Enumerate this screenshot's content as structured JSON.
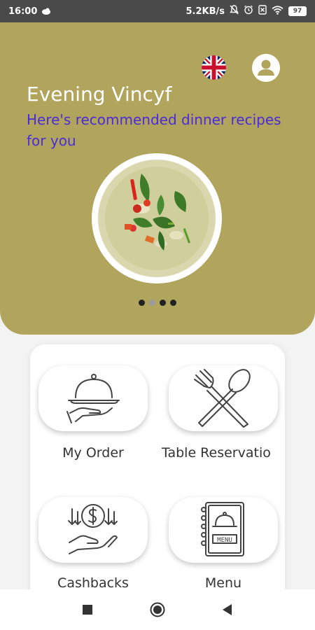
{
  "status_bar": {
    "time": "16:00",
    "net_speed": "5.2KB/s",
    "battery": "97"
  },
  "hero": {
    "greeting": "Evening Vincyf",
    "subtitle": "Here's recommended dinner recipes for you",
    "carousel": {
      "count": 4,
      "active_index": 1
    }
  },
  "menu": {
    "items": [
      {
        "label": "My Order",
        "icon": "cloche-icon"
      },
      {
        "label": "Table Reservatio",
        "icon": "fork-spoon-icon"
      },
      {
        "label": "Cashbacks",
        "icon": "cashback-icon"
      },
      {
        "label": "Menu",
        "icon": "menu-book-icon"
      }
    ]
  },
  "colors": {
    "hero_bg": "#b1a55e",
    "subtitle": "#4a2bd6",
    "status_bar_bg": "#4a4a4a"
  }
}
